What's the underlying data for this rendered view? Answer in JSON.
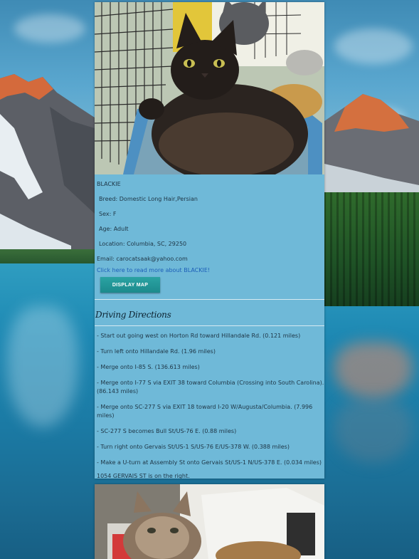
{
  "pet": {
    "name": "BLACKIE",
    "breed": "Breed: Domestic Long Hair,Persian",
    "sex": "Sex: F",
    "age": "Age: Adult",
    "location": "Location: Columbia, SC, 29250",
    "email": "Email: carocatsaak@yahoo.com",
    "read_more": "Click here to read more about BLACKIE!",
    "map_button": "DISPLAY MAP"
  },
  "directions": {
    "title": "Driving Directions",
    "steps": [
      "- Start out going west on Horton Rd toward Hillandale Rd. (0.121 miles)",
      "- Turn left onto Hillandale Rd. (1.96 miles)",
      "- Merge onto I-85 S. (136.613 miles)",
      "- Merge onto I-77 S via EXIT 38 toward Columbia (Crossing into South Carolina). (86.143 miles)",
      "- Merge onto SC-277 S via EXIT 18 toward I-20 W/Augusta/Columbia. (7.996 miles)",
      "- SC-277 S becomes Bull St/US-76 E. (0.88 miles)",
      "- Turn right onto Gervais St/US-1 S/US-76 E/US-378 W. (0.388 miles)",
      "- Make a U-turn at Assembly St onto Gervais St/US-1 N/US-378 E. (0.034 miles)"
    ],
    "destination": "1054 GERVAIS ST is on the right."
  },
  "colors": {
    "card_bg": "#6fb9d8",
    "button": "#1f9a9b",
    "link": "#1d5fb8"
  }
}
